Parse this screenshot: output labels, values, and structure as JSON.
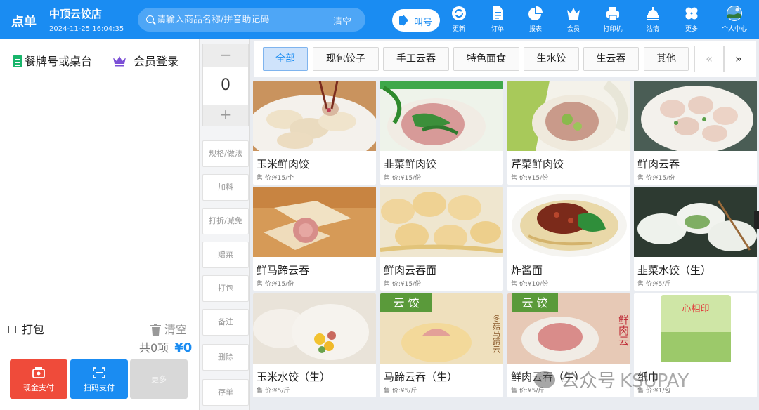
{
  "header": {
    "app_title": "点单",
    "store_name": "中顶云饺店",
    "datetime": "2024-11-25 16:04:35",
    "search_placeholder": "请输入商品名称/拼音助记码",
    "search_clear": "清空",
    "call_button": "叫号",
    "toolbar": [
      {
        "icon": "refresh-icon",
        "label": "更新"
      },
      {
        "icon": "order-document-icon",
        "label": "订单"
      },
      {
        "icon": "pie-chart-icon",
        "label": "报表"
      },
      {
        "icon": "crown-icon",
        "label": "会员"
      },
      {
        "icon": "printer-icon",
        "label": "打印机"
      },
      {
        "icon": "cleanup-icon",
        "label": "沽清"
      },
      {
        "icon": "more-grid-icon",
        "label": "更多"
      },
      {
        "icon": "user-avatar-icon",
        "label": "个人中心"
      }
    ]
  },
  "left_panel": {
    "table_number": "餐牌号或桌台",
    "member_login": "会员登录",
    "pack_label": "打包",
    "clear_label": "清空",
    "total_count": "共0项",
    "total_amount": "¥0",
    "pay_cash": "现金支付",
    "pay_scan": "扫码支付",
    "pay_more": "更多"
  },
  "middle": {
    "quantity": "0",
    "minus": "−",
    "plus": "+",
    "actions": [
      "规格/做法",
      "加料",
      "打折/减免",
      "赠菜",
      "打包",
      "备注",
      "删除",
      "存单"
    ]
  },
  "categories": [
    "全部",
    "现包饺子",
    "手工云吞",
    "特色面食",
    "生水饺",
    "生云吞",
    "其他"
  ],
  "active_category": "全部",
  "pager": {
    "prev": "«",
    "next": "»"
  },
  "products": [
    {
      "name": "玉米鲜肉饺",
      "price": "售 价:¥15/个",
      "image": "dumpling-plate"
    },
    {
      "name": "韭菜鲜肉饺",
      "price": "售 价:¥15/份",
      "image": "chive-dumpling"
    },
    {
      "name": "芹菜鲜肉饺",
      "price": "售 价:¥15/份",
      "image": "celery-dumpling"
    },
    {
      "name": "鲜肉云吞",
      "price": "售 价:¥15/份",
      "image": "wonton-bowl"
    },
    {
      "name": "鲜马蹄云吞",
      "price": "售 价:¥15/份",
      "image": "wonton-cut"
    },
    {
      "name": "鲜肉云吞面",
      "price": "售 价:¥15/份",
      "image": "wonton-noodle"
    },
    {
      "name": "炸酱面",
      "price": "售 价:¥10/份",
      "image": "zhajiang-noodle"
    },
    {
      "name": "韭菜水饺（生）",
      "price": "售 价:¥5/斤",
      "image": "raw-chive-dumpling"
    },
    {
      "name": "玉米水饺（生）",
      "price": "售 价:¥5/斤",
      "image": "corn-dumpling"
    },
    {
      "name": "马蹄云吞（生）",
      "price": "售 价:¥5/斤",
      "image": "raw-wonton",
      "image_text": "云 饺",
      "image_side_text": "冬菇马蹄云"
    },
    {
      "name": "鲜肉云吞（生）",
      "price": "售 价:¥5/斤",
      "image": "raw-meat-wonton",
      "image_text": "云 饺",
      "image_side_text": "鲜肉云"
    },
    {
      "name": "纸巾",
      "price": "售 价:¥1/包",
      "image": "tissue-pack",
      "image_text": "心相印"
    }
  ],
  "watermark": {
    "text": "公众号",
    "sub": "KSUPAY"
  },
  "colors": {
    "primary": "#1a8cf2",
    "cash": "#ef4b3a",
    "green": "#19b56b",
    "member": "#7b4fd6"
  }
}
